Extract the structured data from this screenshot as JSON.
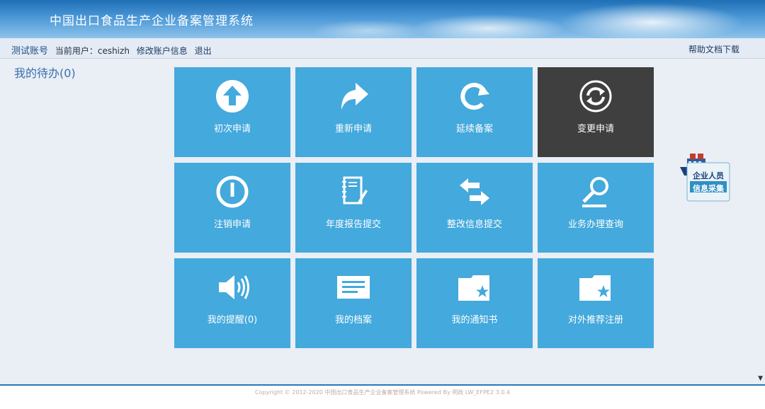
{
  "header": {
    "title": "中国出口食品生产企业备案管理系统"
  },
  "navbar": {
    "account": "测试账号",
    "current_user_label": "当前用户：ceshizh",
    "edit_account": "修改账户信息",
    "logout": "退出",
    "help_download": "帮助文档下载"
  },
  "todo": {
    "label": "我的待办(0)"
  },
  "tiles": [
    {
      "label": "初次申请",
      "icon": "upload-arrow-icon"
    },
    {
      "label": "重新申请",
      "icon": "redo-arrow-icon"
    },
    {
      "label": "延续备案",
      "icon": "refresh-icon"
    },
    {
      "label": "变更申请",
      "icon": "cycle-icon",
      "color": "#3f3f3f"
    },
    {
      "label": "注销申请",
      "icon": "power-icon"
    },
    {
      "label": "年度报告提交",
      "icon": "notebook-icon"
    },
    {
      "label": "整改信息提交",
      "icon": "exchange-arrows-icon"
    },
    {
      "label": "业务办理查询",
      "icon": "magnifier-icon"
    },
    {
      "label": "我的提醒(0)",
      "icon": "speaker-icon"
    },
    {
      "label": "我的档案",
      "icon": "document-card-icon"
    },
    {
      "label": "我的通知书",
      "icon": "starred-folder-icon"
    },
    {
      "label": "对外推荐注册",
      "icon": "starred-folder-icon"
    }
  ],
  "widget": {
    "line1": "企业人员",
    "line2": "信息采集",
    "icon": "ship-icon"
  },
  "footer": {
    "text": "Copyright © 2012-2020 中国出口食品生产企业备案管理系统 Powered By 明政 LW_EFPE2 3.0.4"
  },
  "colors": {
    "tile": "#44a9dc",
    "tile_active": "#3f3f3f",
    "footer_line": "#2f7bbd"
  }
}
